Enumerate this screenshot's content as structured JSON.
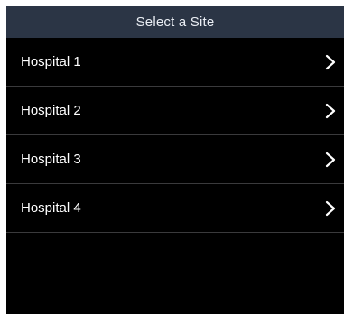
{
  "navbar": {
    "title": "Select a Site"
  },
  "sites": [
    {
      "label": "Hospital 1",
      "icon": "chevron-right-icon"
    },
    {
      "label": "Hospital 2",
      "icon": "chevron-right-icon"
    },
    {
      "label": "Hospital 3",
      "icon": "chevron-right-icon"
    },
    {
      "label": "Hospital 4",
      "icon": "chevron-right-icon"
    }
  ],
  "colors": {
    "navbar_background": "#2b3545",
    "screen_background": "#000000",
    "row_text": "#ffffff",
    "separator": "#3a3a3c"
  }
}
